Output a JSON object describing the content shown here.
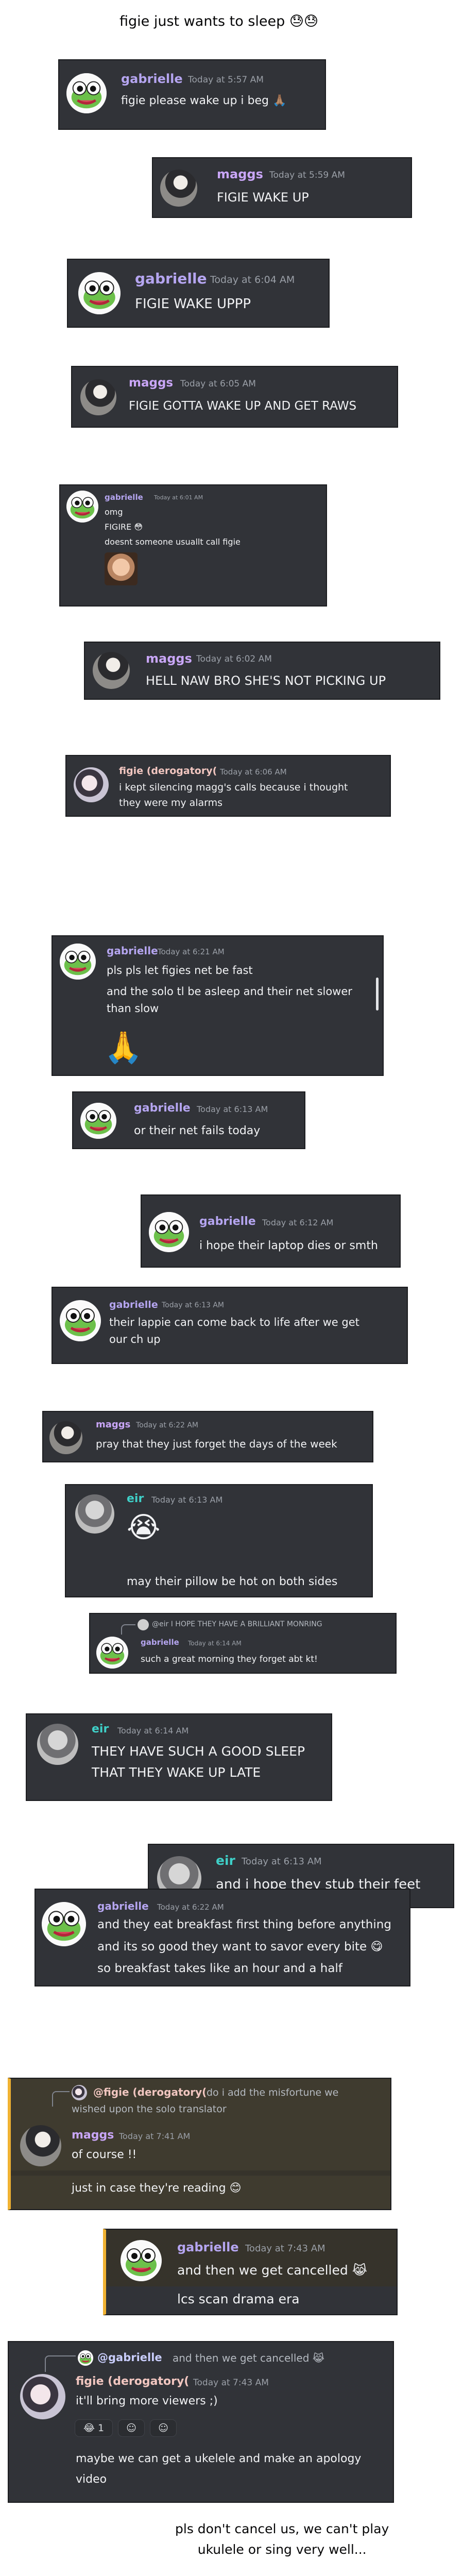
{
  "top_caption": "figie just wants to sleep 😓😓",
  "bottom_caption_line1": "pls don't cancel us, we can't play",
  "bottom_caption_line2": "ukulele or sing very well...",
  "messages": [
    {
      "name": "gabrielle",
      "ts": "Today at 5:57 AM",
      "lines": [
        "figie please wake up i beg 🙏🏽"
      ]
    },
    {
      "name": "maggs",
      "ts": "Today at 5:59 AM",
      "lines": [
        "FIGIE WAKE UP"
      ]
    },
    {
      "name": "gabrielle",
      "ts": "Today at 6:04 AM",
      "lines": [
        "FIGIE WAKE UPPP"
      ]
    },
    {
      "name": "maggs",
      "ts": "Today at 6:05 AM",
      "lines": [
        "FIGIE GOTTA WAKE UP AND GET RAWS"
      ]
    },
    {
      "name": "gabrielle",
      "ts": "Today at 6:01 AM",
      "lines": [
        "omg",
        "FIGIRE 😳",
        "doesnt someone usuallt call figie"
      ]
    },
    {
      "name": "maggs",
      "ts": "Today at 6:02 AM",
      "lines": [
        "HELL NAW BRO SHE'S NOT PICKING UP"
      ]
    },
    {
      "name": "figie (derogatory(",
      "ts": "Today at 6:06 AM",
      "lines": [
        "i kept silencing magg's calls because i thought",
        "they were my alarms"
      ]
    },
    {
      "name": "gabrielle",
      "ts": "Today at 6:21 AM",
      "lines": [
        "pls pls let figies net be fast",
        "and the solo tl be asleep and their net slower",
        "than slow",
        "🙏"
      ]
    },
    {
      "name": "gabrielle",
      "ts": "Today at 6:13 AM",
      "lines": [
        "or their net fails today"
      ]
    },
    {
      "name": "gabrielle",
      "ts": "Today at 6:12 AM",
      "lines": [
        "i hope their laptop dies or smth"
      ]
    },
    {
      "name": "gabrielle",
      "ts": "Today at 6:13 AM",
      "lines": [
        "their lappie can come back to life after we get",
        "our ch up"
      ]
    },
    {
      "name": "maggs",
      "ts": "Today at 6:22 AM",
      "lines": [
        "pray that they just forget the days of the week"
      ]
    },
    {
      "name": "eir",
      "ts": "Today at 6:13 AM",
      "lines": [
        "😭",
        "may their pillow be hot on both sides"
      ]
    },
    {
      "reply": "@eir I HOPE THEY HAVE A BRILLIANT MONRING",
      "name": "gabrielle",
      "ts": "Today at 6:14 AM",
      "lines": [
        "such a great morning they forget abt kt!"
      ]
    },
    {
      "name": "eir",
      "ts": "Today at 6:14 AM",
      "lines": [
        "THEY HAVE SUCH A GOOD SLEEP",
        "THAT THEY WAKE UP LATE"
      ]
    },
    {
      "name": "eir",
      "ts": "Today at 6:13 AM",
      "lines": [
        "and i hope they stub their feet"
      ]
    },
    {
      "name": "gabrielle",
      "ts": "Today at 6:22 AM",
      "lines": [
        "and they eat breakfast first thing before anything",
        "and its so good they want to savor every bite 😋",
        "so breakfast takes like an hour and a half"
      ]
    },
    {
      "reply_name": "@figie (derogatory(",
      "reply_text": "do i add the misfortune we",
      "reply_text2": "wished upon the solo translator",
      "name": "maggs",
      "ts": "Today at 7:41 AM",
      "lines": [
        "of course !!",
        "just in case they're reading 😊"
      ]
    },
    {
      "name": "gabrielle",
      "ts": "Today at 7:43 AM",
      "lines": [
        "and then we get cancelled 😹",
        "lcs scan drama era"
      ]
    },
    {
      "reply_name": "@gabrielle",
      "reply_text": "and then we get cancelled 😹",
      "name": "figie (derogatory(",
      "ts": "Today at 7:43 AM",
      "lines": [
        "it'll bring more viewers ;)",
        "maybe we can get a ukelele and make an apology",
        "video"
      ],
      "reactions": [
        {
          "emoji": "😂",
          "count": "1"
        },
        {
          "emoji": "☺",
          "count": ""
        },
        {
          "emoji": "☺",
          "count": ""
        }
      ]
    }
  ]
}
